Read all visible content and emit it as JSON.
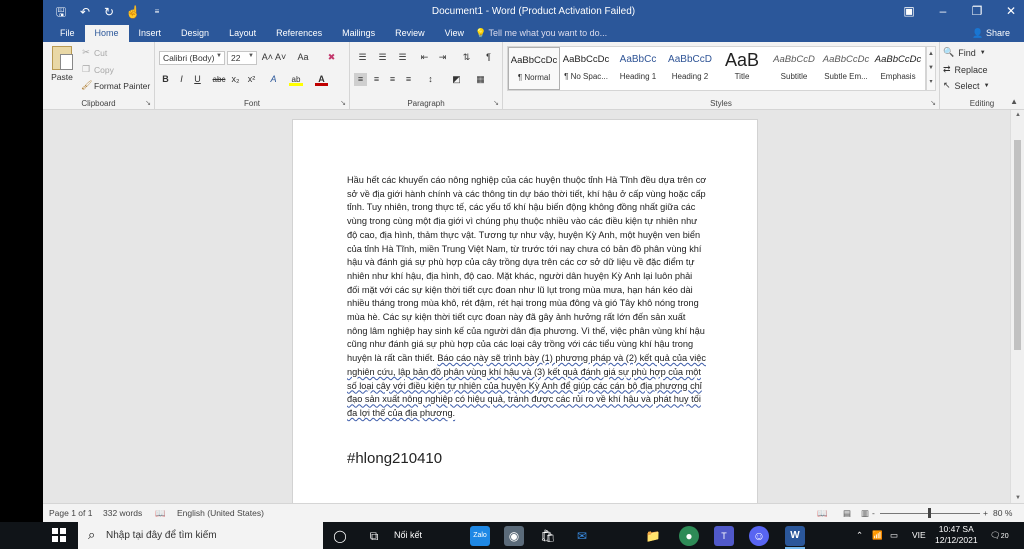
{
  "window": {
    "title": "Document1 - Word (Product Activation Failed)"
  },
  "quick_access": {
    "save_icon": "save-icon",
    "undo_icon": "undo-icon",
    "redo_icon": "redo-icon",
    "touch_mode_icon": "touch-mode-icon",
    "customize_icon": "customize-qat-icon"
  },
  "tabs": [
    "File",
    "Home",
    "Insert",
    "Design",
    "Layout",
    "References",
    "Mailings",
    "Review",
    "View"
  ],
  "active_tab": "Home",
  "tell_me": "Tell me what you want to do...",
  "share_label": "Share",
  "clipboard": {
    "paste": "Paste",
    "cut": "Cut",
    "copy": "Copy",
    "format_painter": "Format Painter",
    "label": "Clipboard"
  },
  "font": {
    "name": "Calibri (Body)",
    "size": "22",
    "label": "Font",
    "grow_shrink": "A˄ A˅",
    "change_case": "Aa",
    "bold": "B",
    "italic": "I",
    "underline": "U",
    "strike": "abc",
    "subscript": "x₂",
    "superscript": "x²",
    "text_effects": "A",
    "highlight": "ab",
    "font_color": "A"
  },
  "paragraph": {
    "label": "Paragraph"
  },
  "styles": {
    "label": "Styles",
    "items": [
      {
        "preview": "AaBbCcDc",
        "name": "¶ Normal"
      },
      {
        "preview": "AaBbCcDc",
        "name": "¶ No Spac..."
      },
      {
        "preview": "AaBbCc",
        "name": "Heading 1"
      },
      {
        "preview": "AaBbCcD",
        "name": "Heading 2"
      },
      {
        "preview": "AaB",
        "name": "Title"
      },
      {
        "preview": "AaBbCcD",
        "name": "Subtitle"
      },
      {
        "preview": "AaBbCcDc",
        "name": "Subtle Em..."
      },
      {
        "preview": "AaBbCcDc",
        "name": "Emphasis"
      }
    ]
  },
  "editing": {
    "find": "Find",
    "replace": "Replace",
    "select": "Select",
    "label": "Editing"
  },
  "document": {
    "body_plain": "Hầu hết các khuyến cáo nông nghiệp của các huyện thuộc tỉnh Hà Tĩnh đều dựa trên cơ sở về địa giới hành chính và các thông tin dự báo thời tiết, khí hậu ở cấp vùng hoặc cấp tỉnh. Tuy nhiên, trong thực tế, các yếu tố khí hậu biến động không đồng nhất giữa các vùng trong cùng một địa giới vì chúng phụ thuộc nhiều vào các điều kiện tự nhiên như độ cao, địa hình, thảm thực vật. Tương tự như vậy, huyện Kỳ Anh, một huyện ven biển của tỉnh Hà Tĩnh, miền Trung Việt Nam, từ trước tới nay chưa có bản đồ phân vùng khí hậu và đánh giá sự phù hợp của cây trồng dựa trên các cơ sở dữ liệu về đặc điểm tự nhiên như khí hậu, địa hình, độ cao. Mặt khác, người dân huyện Kỳ Anh lại luôn phải đối mặt với các sự kiện thời tiết cực đoan như lũ lụt trong mùa mưa, hạn hán kéo dài nhiều tháng trong mùa khô, rét đậm, rét hại trong mùa đông và gió Tây khô nóng trong mùa hè. Các sự kiện thời tiết cực đoan này đã gây ảnh hưởng rất lớn đến sản xuất nông lâm nghiệp hay sinh kế của người dân địa phương. Vì thế, việc phân vùng khí hậu cũng như đánh giá sự phù hợp của các loại cây trồng với các tiểu vùng khí hậu trong huyện là rất cần thiết. ",
    "body_underlined": "Báo cáo này sẽ trình bày (1) phương pháp và (2) kết quả của việc nghiên cứu, lập bản đồ phân vùng khí hậu và (3) kết quả đánh giá sự phù hợp của một số loại cây với điều kiện tự nhiên của huyện Kỳ Anh để giúp các cán bộ địa phương chỉ đạo sản xuất nông nghiệp có hiệu quả, tránh được các rủi ro về khí hậu và phát huy tối đa lợi thế của địa phương.",
    "hashtag": "#hlong210410"
  },
  "status": {
    "page": "Page 1 of 1",
    "words": "332 words",
    "language": "English (United States)",
    "zoom_minus": "-",
    "zoom_plus": "+",
    "zoom": "80 %"
  },
  "taskbar": {
    "search_placeholder": "Nhập tại đây để tìm kiếm",
    "news_label": "Nối kết",
    "lang": "VIE",
    "time": "10:47 SA",
    "date": "12/12/2021",
    "notifications": "20"
  },
  "colors": {
    "word_blue": "#2b579a",
    "taskbar": "#101418"
  }
}
